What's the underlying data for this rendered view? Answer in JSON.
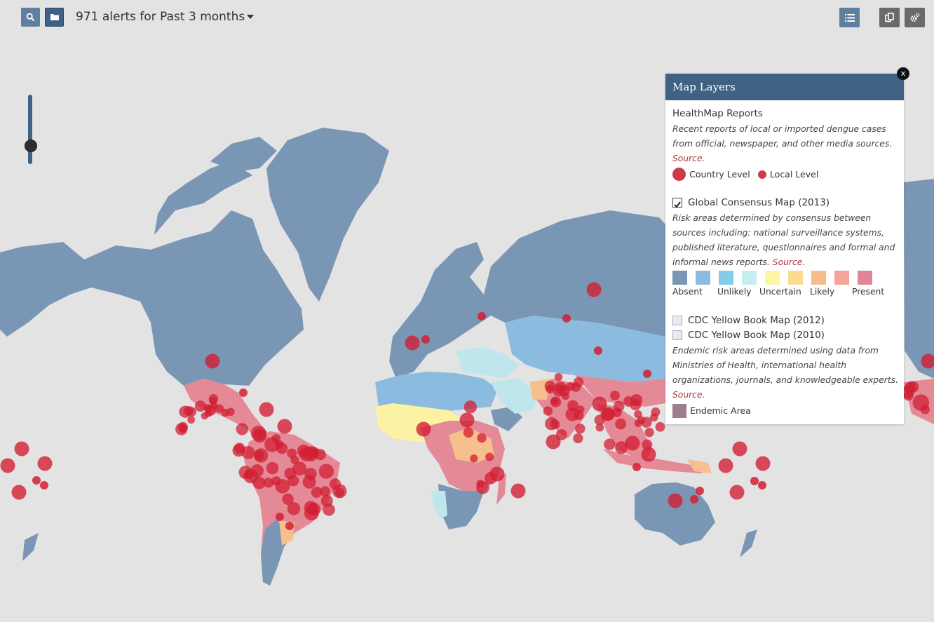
{
  "toolbar": {
    "alerts_text": "971 alerts for Past 3 months",
    "search_icon": "search-icon",
    "folder_icon": "folder-icon",
    "list_icon": "list-icon",
    "copy_icon": "copy-icon",
    "settings_icon": "gear-icon"
  },
  "map": {
    "colors": {
      "ocean": "#e3e3e3",
      "absent": "#7a96b5",
      "unlikely": "#8cbbe0",
      "uncertain": "#bfe6ec",
      "likely_yellow": "#fbf2a4",
      "likely": "#f6bf8d",
      "present": "#e48a97",
      "alert": "#d21f33"
    },
    "zoom_level_fraction": 0.35
  },
  "layers_panel": {
    "title": "Map Layers",
    "close_label": "x",
    "healthmap": {
      "title": "HealthMap Reports",
      "description": "Recent reports of local or imported dengue cases from official, newspaper, and other media sources.",
      "source_link": "Source.",
      "legend": {
        "country": "Country Level",
        "local": "Local Level"
      }
    },
    "consensus": {
      "checked": true,
      "title": "Global Consensus Map (2013)",
      "description": "Risk areas determined by consensus between sources including: national surveillance systems, published literature, questionnaires and formal and informal news reports.",
      "source_link": "Source.",
      "scale": [
        {
          "label": "Absent",
          "color": "#7a96b5"
        },
        {
          "label": "",
          "color": "#8cbbe0"
        },
        {
          "label": "Unlikely",
          "color": "#84cdea"
        },
        {
          "label": "",
          "color": "#c6eef0"
        },
        {
          "label": "Uncertain",
          "color": "#fbf7a6"
        },
        {
          "label": "",
          "color": "#fbdc8e"
        },
        {
          "label": "Likely",
          "color": "#f8bd8b"
        },
        {
          "label": "",
          "color": "#f6a497"
        },
        {
          "label": "Present",
          "color": "#e3849a"
        }
      ]
    },
    "cdc": {
      "map_2012": "CDC Yellow Book Map (2012)",
      "map_2010": "CDC Yellow Book Map (2010)",
      "description": "Endemic risk areas determined using data from Ministries of Health, international health organizations, journals, and knowledgeable experts.",
      "source_link": "Source.",
      "legend_label": "Endemic Area",
      "legend_color": "#9b7f8d"
    }
  }
}
